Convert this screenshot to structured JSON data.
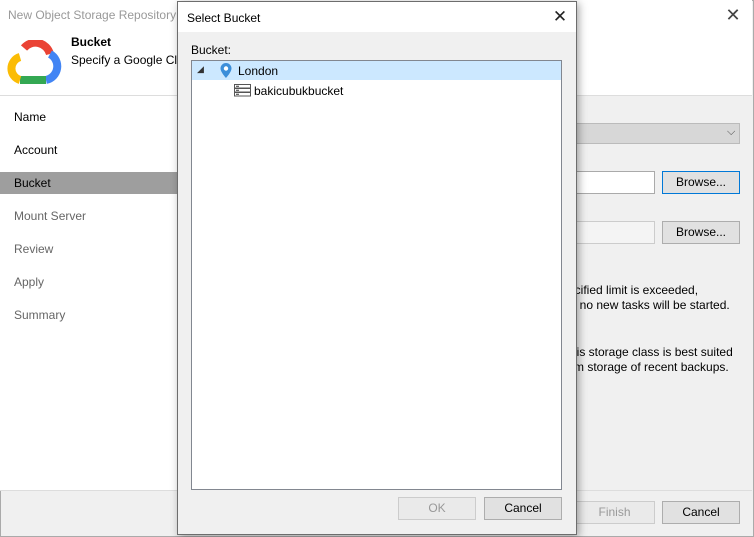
{
  "wizard": {
    "title": "New Object Storage Repository",
    "header_title": "Bucket",
    "header_subtitle": "Specify a Google Clo",
    "nav": [
      {
        "label": "Name"
      },
      {
        "label": "Account"
      },
      {
        "label": "Bucket"
      },
      {
        "label": "Mount Server"
      },
      {
        "label": "Review"
      },
      {
        "label": "Apply"
      },
      {
        "label": "Summary"
      }
    ],
    "browse1_label": "Browse...",
    "browse2_label": "Browse...",
    "text_line1": "ecified limit is exceeded,",
    "text_line2": "t no new tasks will be started.",
    "text_line3": "his storage class is best suited",
    "text_line4": "rm storage of recent backups.",
    "finish_label": "Finish",
    "cancel_label": "Cancel",
    "close_glyph": "✕"
  },
  "dialog": {
    "title": "Select Bucket",
    "close_glyph": "✕",
    "bucket_label": "Bucket:",
    "tree": {
      "region": "London",
      "bucket": "bakicubukbucket"
    },
    "ok_label": "OK",
    "cancel_label": "Cancel"
  },
  "colors": {
    "selection": "#cce8ff",
    "nav_active": "#9e9e9e",
    "pin": "#3b8ed9"
  }
}
